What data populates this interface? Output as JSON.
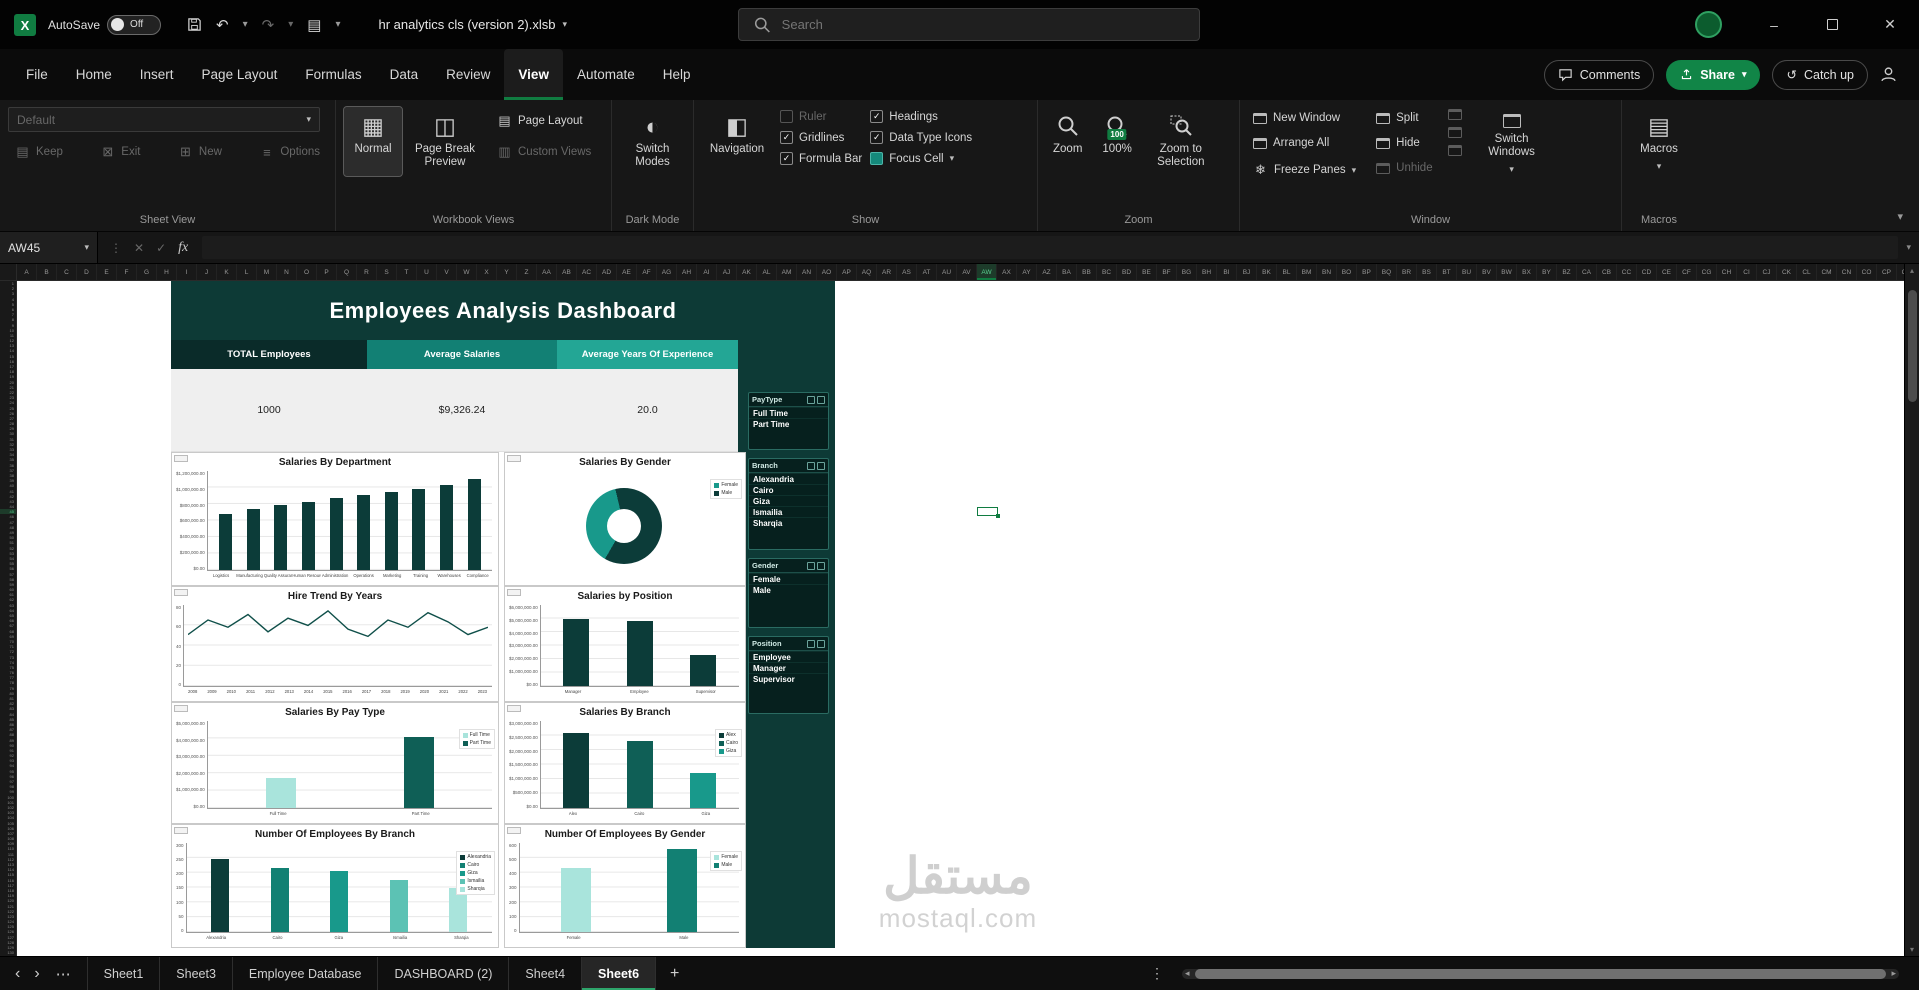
{
  "titlebar": {
    "autosave_label": "AutoSave",
    "autosave_state": "Off",
    "filename": "hr analytics cls (version 2).xlsb",
    "search_placeholder": "Search"
  },
  "ribbon_tabs": {
    "items": [
      "File",
      "Home",
      "Insert",
      "Page Layout",
      "Formulas",
      "Data",
      "Review",
      "View",
      "Automate",
      "Help"
    ],
    "active": "View",
    "comments_label": "Comments",
    "share_label": "Share",
    "catchup_label": "Catch up"
  },
  "ribbon": {
    "sheet_view": {
      "label": "Sheet View",
      "dropdown_value": "Default",
      "buttons": [
        "Keep",
        "Exit",
        "New",
        "Options"
      ]
    },
    "workbook_views": {
      "label": "Workbook Views",
      "big_buttons": [
        "Normal",
        "Page Break Preview"
      ],
      "small_buttons": [
        "Page Layout",
        "Custom Views"
      ],
      "active": "Normal"
    },
    "dark_mode": {
      "label": "Dark Mode",
      "button": "Switch Modes"
    },
    "show": {
      "label": "Show",
      "nav_button": "Navigation",
      "col1": [
        {
          "label": "Ruler",
          "checked": false,
          "disabled": true
        },
        {
          "label": "Gridlines",
          "checked": true,
          "disabled": false
        },
        {
          "label": "Formula Bar",
          "checked": true,
          "disabled": false
        }
      ],
      "col2": [
        {
          "label": "Headings",
          "checked": true,
          "disabled": false
        },
        {
          "label": "Data Type Icons",
          "checked": true,
          "disabled": false
        },
        {
          "label": "Focus Cell",
          "checked": true,
          "disabled": false,
          "special": true
        }
      ]
    },
    "zoom": {
      "label": "Zoom",
      "zoom_button": "Zoom",
      "pct_button": "100%",
      "pct_badge": "100",
      "selection_button": "Zoom to Selection"
    },
    "window": {
      "label": "Window",
      "col1": [
        "New Window",
        "Arrange All",
        "Freeze Panes"
      ],
      "col2": [
        "Split",
        "Hide",
        "Unhide"
      ],
      "switch_button": "Switch Windows"
    },
    "macros": {
      "label": "Macros",
      "button": "Macros"
    }
  },
  "formula_bar": {
    "name_box": "AW45",
    "fx": "fx",
    "formula": ""
  },
  "sheet": {
    "columns": [
      "A",
      "B",
      "C",
      "D",
      "E",
      "F",
      "G",
      "H",
      "I",
      "J",
      "K",
      "L",
      "M",
      "N",
      "O",
      "P",
      "Q",
      "R",
      "S",
      "T",
      "U",
      "V",
      "W",
      "X",
      "Y",
      "Z",
      "AA",
      "AB",
      "AC",
      "AD",
      "AE",
      "AF",
      "AG",
      "AH",
      "AI",
      "AJ",
      "AK",
      "AL",
      "AM",
      "AN",
      "AO",
      "AP",
      "AQ",
      "AR",
      "AS",
      "AT",
      "AU",
      "AV",
      "AW",
      "AX",
      "AY",
      "AZ",
      "BA",
      "BB",
      "BC",
      "BD",
      "BE",
      "BF",
      "BG",
      "BH",
      "BI",
      "BJ",
      "BK",
      "BL",
      "BM",
      "BN",
      "BO",
      "BP",
      "BQ",
      "BR",
      "BS",
      "BT",
      "BU",
      "BV",
      "BW",
      "BX",
      "BY",
      "BZ",
      "CA",
      "CB",
      "CC",
      "CD",
      "CE",
      "CF",
      "CG",
      "CH",
      "CI",
      "CJ",
      "CK",
      "CL",
      "CM",
      "CN",
      "CO",
      "CP",
      "CQ"
    ],
    "selected_column": "AW",
    "selected_row": 45,
    "row_count": 130
  },
  "dashboard": {
    "title": "Employees Analysis Dashboard",
    "kpis": [
      {
        "label": "TOTAL Employees",
        "value": "1000",
        "color": "#0a2b29"
      },
      {
        "label": "Average Salaries",
        "value": "$9,326.24",
        "color": "#128074"
      },
      {
        "label": "Average Years Of Experience",
        "value": "20.0",
        "color": "#23a695"
      }
    ],
    "slicers": [
      {
        "name": "PayType",
        "items": [
          "Full Time",
          "Part Time"
        ]
      },
      {
        "name": "Branch",
        "items": [
          "Alexandria",
          "Cairo",
          "Giza",
          "Ismailia",
          "Sharqia"
        ]
      },
      {
        "name": "Gender",
        "items": [
          "Female",
          "Male"
        ]
      },
      {
        "name": "Position",
        "items": [
          "Employee",
          "Manager",
          "Supervisor"
        ]
      }
    ]
  },
  "chart_data": [
    {
      "id": "salaries-by-department",
      "type": "bar",
      "title": "Salaries By Department",
      "categories": [
        "Logistics",
        "Manufacturing",
        "Quality Assurance",
        "Human Resources",
        "Administration",
        "Operations",
        "Marketing",
        "Training",
        "Warehouses",
        "Compliance"
      ],
      "values": [
        680000,
        740000,
        790000,
        830000,
        870000,
        905000,
        940000,
        980000,
        1030000,
        1100000
      ],
      "ylim": [
        0,
        1200000
      ],
      "yticks": [
        "$1,200,000.00",
        "$1,000,000.00",
        "$800,000.00",
        "$600,000.00",
        "$400,000.00",
        "$200,000.00",
        "$0.00"
      ],
      "color": "#0c3c39"
    },
    {
      "id": "salaries-by-gender",
      "type": "donut",
      "title": "Salaries By Gender",
      "slices": [
        {
          "label": "Female",
          "value": 38,
          "color": "#18998b"
        },
        {
          "label": "Male",
          "value": 62,
          "color": "#0c3c39"
        }
      ],
      "legend": [
        {
          "label": "Female",
          "color": "#18998b"
        },
        {
          "label": "Male",
          "color": "#0c3c39"
        }
      ]
    },
    {
      "id": "hire-trend-by-years",
      "type": "line",
      "title": "Hire Trend By Years",
      "x": [
        "2008",
        "2009",
        "2010",
        "2011",
        "2012",
        "2013",
        "2014",
        "2015",
        "2016",
        "2017",
        "2018",
        "2019",
        "2020",
        "2021",
        "2022",
        "2023"
      ],
      "values": [
        52,
        68,
        60,
        74,
        55,
        70,
        62,
        78,
        58,
        50,
        68,
        60,
        76,
        66,
        52,
        60
      ],
      "ylim": [
        0,
        80
      ],
      "yticks": [
        "80",
        "60",
        "40",
        "20",
        "0"
      ],
      "color": "#0f4f49"
    },
    {
      "id": "salaries-by-position",
      "type": "bar",
      "title": "Salaries by Position",
      "categories": [
        "Manager",
        "Employee",
        "Supervisor"
      ],
      "values": [
        5000000,
        4800000,
        2300000
      ],
      "ylim": [
        0,
        6000000
      ],
      "yticks": [
        "$6,000,000.00",
        "$5,000,000.00",
        "$4,000,000.00",
        "$3,000,000.00",
        "$2,000,000.00",
        "$1,000,000.00",
        "$0.00"
      ],
      "color": "#0c3c39"
    },
    {
      "id": "salaries-by-pay-type",
      "type": "bar",
      "title": "Salaries By Pay Type",
      "categories": [
        "Full Time",
        "Part Time"
      ],
      "values": [
        1700000,
        4100000
      ],
      "ylim": [
        0,
        5000000
      ],
      "yticks": [
        "$5,000,000.00",
        "$4,000,000.00",
        "$3,000,000.00",
        "$2,000,000.00",
        "$1,000,000.00",
        "$0.00"
      ],
      "bar_colors": [
        "#a9e4dc",
        "#0f5f56"
      ],
      "legend": [
        {
          "label": "Full Time",
          "color": "#a9e4dc"
        },
        {
          "label": "Part Time",
          "color": "#0f5f56"
        }
      ]
    },
    {
      "id": "salaries-by-branch",
      "type": "bar",
      "title": "Salaries By Branch",
      "categories": [
        "Alex",
        "Cairo",
        "Giza"
      ],
      "values": [
        2600000,
        2300000,
        1200000
      ],
      "ylim": [
        0,
        3000000
      ],
      "yticks": [
        "$3,000,000.00",
        "$2,500,000.00",
        "$2,000,000.00",
        "$1,500,000.00",
        "$1,000,000.00",
        "$500,000.00",
        "$0.00"
      ],
      "bar_colors": [
        "#0c3c39",
        "#0f5f56",
        "#18998b"
      ],
      "legend": [
        {
          "label": "Alex",
          "color": "#0c3c39"
        },
        {
          "label": "Cairo",
          "color": "#0f5f56"
        },
        {
          "label": "Giza",
          "color": "#18998b"
        }
      ]
    },
    {
      "id": "employees-by-branch",
      "type": "bar",
      "title": "Number Of Employees By Branch",
      "categories": [
        "Alexandria",
        "Cairo",
        "Giza",
        "Ismailia",
        "Sharqia"
      ],
      "values": [
        245,
        215,
        205,
        175,
        150
      ],
      "ylim": [
        0,
        300
      ],
      "yticks": [
        "300",
        "250",
        "200",
        "150",
        "100",
        "50",
        "0"
      ],
      "bar_colors": [
        "#0c3c39",
        "#128073",
        "#18998b",
        "#5cc2b4",
        "#a9e4dc"
      ],
      "legend": [
        {
          "label": "Alexandria",
          "color": "#0c3c39"
        },
        {
          "label": "Cairo",
          "color": "#128073"
        },
        {
          "label": "Giza",
          "color": "#18998b"
        },
        {
          "label": "Ismailia",
          "color": "#5cc2b4"
        },
        {
          "label": "Sharqia",
          "color": "#a9e4dc"
        }
      ]
    },
    {
      "id": "employees-by-gender",
      "type": "bar",
      "title": "Number Of Employees By Gender",
      "categories": [
        "Female",
        "Male"
      ],
      "values": [
        430,
        560
      ],
      "ylim": [
        0,
        600
      ],
      "yticks": [
        "600",
        "500",
        "400",
        "300",
        "200",
        "100",
        "0"
      ],
      "bar_colors": [
        "#a9e4dc",
        "#128073"
      ],
      "legend": [
        {
          "label": "Female",
          "color": "#a9e4dc"
        },
        {
          "label": "Male",
          "color": "#128073"
        }
      ]
    }
  ],
  "sheet_tabs": {
    "tabs": [
      "Sheet1",
      "Sheet3",
      "Employee Database",
      "DASHBOARD (2)",
      "Sheet4",
      "Sheet6"
    ],
    "active": "Sheet6"
  },
  "watermark": {
    "arabic": "مستقل",
    "latin": "mostaql.com"
  },
  "icons": {
    "check": "✓",
    "chevron_down": "▾",
    "undo": "↶",
    "redo": "↷",
    "more_h": "⋯",
    "more_v": "⋮",
    "close": "✕",
    "minimize": "–",
    "nav_left": "‹",
    "nav_right": "›",
    "plus": "+",
    "freeze": "❄",
    "normal_view": "▦",
    "page_break": "◫",
    "page_layout": "▤",
    "custom_views": "▥",
    "switch_modes": "◐",
    "navigation": "◧",
    "keep": "▤",
    "exit": "⊠",
    "new": "⊞",
    "options": "≡",
    "macros": "▤",
    "cancel": "✕",
    "catchup": "↺",
    "scroll_up": "▴",
    "scroll_down": "▾",
    "scroll_left": "◂",
    "scroll_right": "▸",
    "qat_extra": "▤"
  },
  "colors": {
    "accent": "#107c41",
    "teal_dark": "#0c3c39",
    "teal_mid": "#128074",
    "teal_light": "#a9e4dc",
    "dashboard_bg": "#0d3a36"
  }
}
